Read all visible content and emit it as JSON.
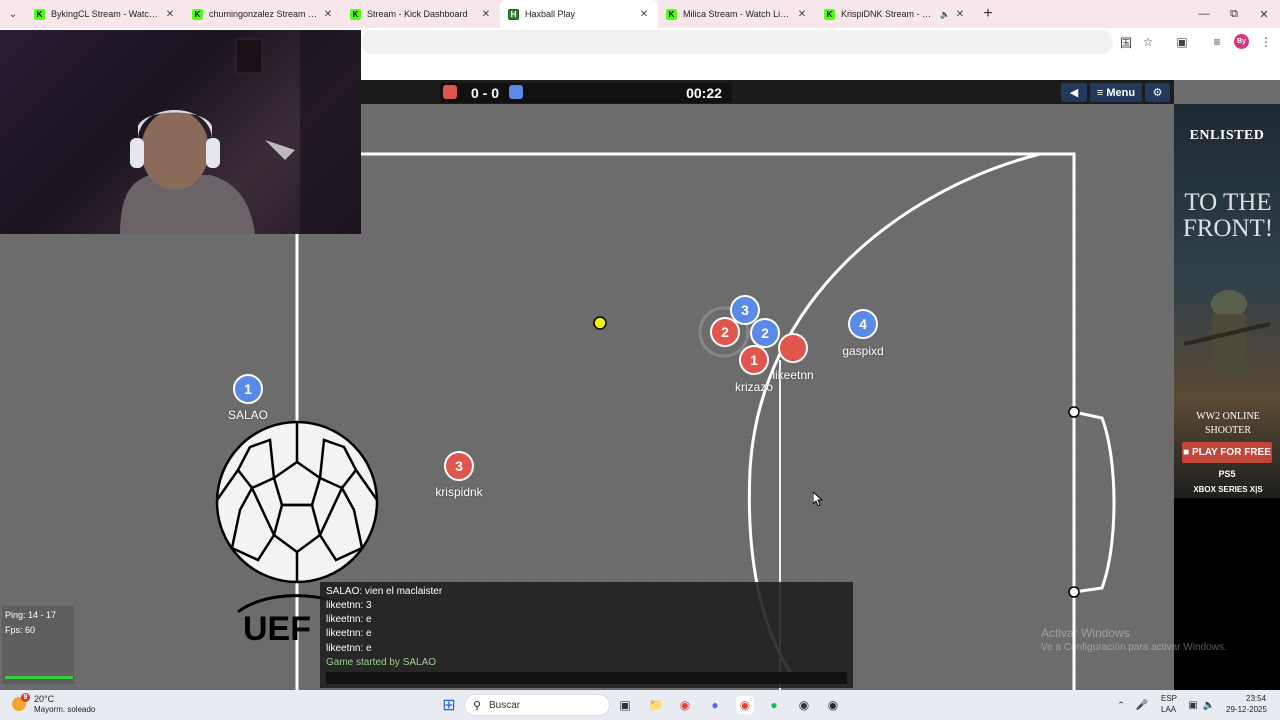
{
  "browser": {
    "tabs": [
      {
        "title": "BykingCL Stream - Watch Live o",
        "favicon": "kick",
        "active": false
      },
      {
        "title": "chumingonzalez Stream - Watc",
        "favicon": "kick",
        "active": false
      },
      {
        "title": "Stream - Kick Dashboard",
        "favicon": "kick",
        "active": false
      },
      {
        "title": "Haxball Play",
        "favicon": "haxball",
        "active": true
      },
      {
        "title": "Milica Stream - Watch Live on",
        "favicon": "kick",
        "active": false
      },
      {
        "title": "KrispiDNK Stream - Watch",
        "favicon": "kick",
        "active": false
      }
    ],
    "profile_initials": "By"
  },
  "hud": {
    "score": "0 - 0",
    "clock": "00:22",
    "menu_label": "Menu",
    "red_color": "#e0564d",
    "blue_color": "#5b89e6"
  },
  "players": [
    {
      "team": "blue",
      "number": "1",
      "name": "SALAO"
    },
    {
      "team": "red",
      "number": "3",
      "name": "krispidnk"
    },
    {
      "team": "blue",
      "number": "3",
      "name": ""
    },
    {
      "team": "red",
      "number": "2",
      "name": ""
    },
    {
      "team": "blue",
      "number": "2",
      "name": ""
    },
    {
      "team": "red",
      "number": "1",
      "name": "krizazo"
    },
    {
      "team": "red",
      "number": "",
      "name": "likeetnn"
    },
    {
      "team": "blue",
      "number": "4",
      "name": "gaspixd"
    }
  ],
  "chat": {
    "lines": [
      {
        "text": "SALAO: vien el maclaister"
      },
      {
        "text": "likeetnn: 3"
      },
      {
        "text": "likeetnn: e"
      },
      {
        "text": "likeetnn: e"
      },
      {
        "text": "likeetnn: e"
      },
      {
        "text": "Game started by SALAO"
      }
    ]
  },
  "stats": {
    "ping": "Ping: 14 - 17",
    "fps": "Fps: 60"
  },
  "ad": {
    "brand": "ENLISTED",
    "headline": "TO THE FRONT!",
    "sub1": "WW2 ONLINE",
    "sub2": "SHOOTER",
    "cta": "PLAY FOR FREE",
    "platform1": "PS5",
    "platform2": "XBOX SERIES X|S"
  },
  "watermark": {
    "line1": "Activar Windows",
    "line2": "Ve a Configuración para activar Windows."
  },
  "taskbar": {
    "weather_badge": "9",
    "temperature": "20°C",
    "weather_desc": "Mayorm. soleado",
    "search_placeholder": "Buscar",
    "lang1": "ESP",
    "lang2": "LAA",
    "time": "23:54",
    "date": "29-12-2025"
  }
}
